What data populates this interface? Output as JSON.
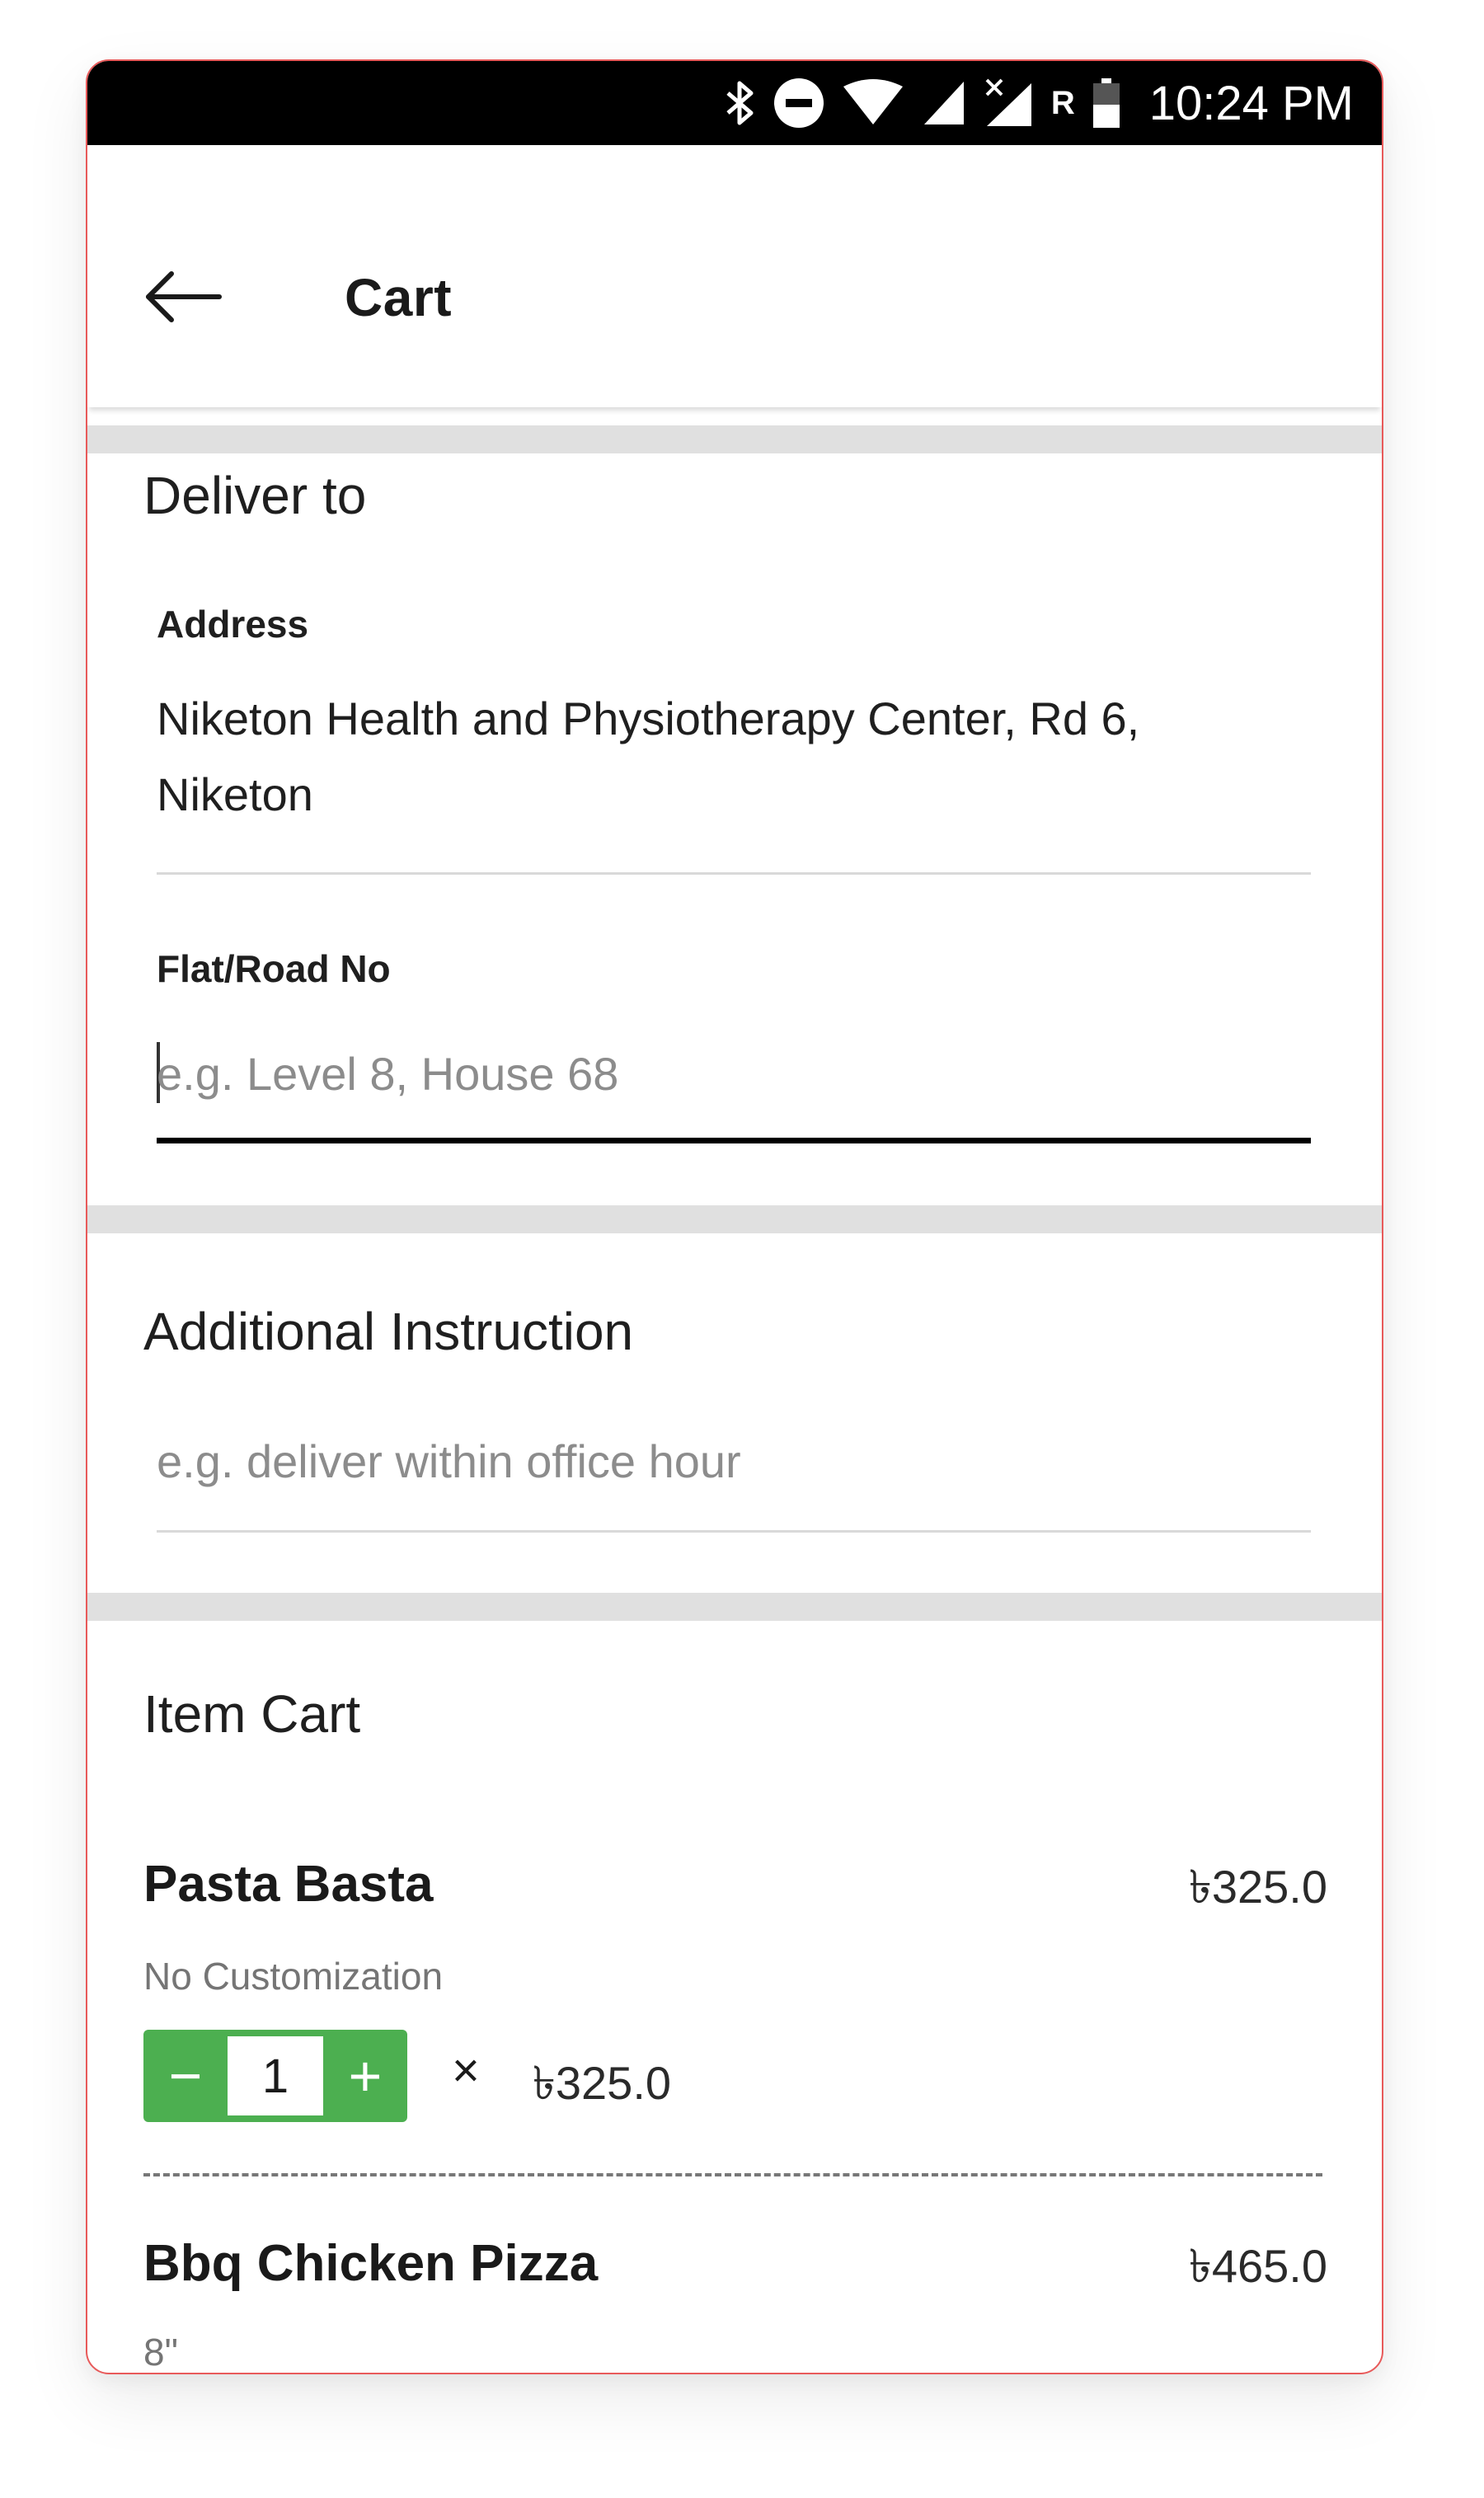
{
  "status_bar": {
    "carrier_letter": "R",
    "time": "10:24 PM",
    "icons": [
      "bluetooth-icon",
      "do-not-disturb-icon",
      "wifi-icon",
      "signal-icon",
      "signal-no-data-icon",
      "battery-icon"
    ]
  },
  "app_bar": {
    "title": "Cart",
    "back_icon": "arrow-left-icon"
  },
  "deliver": {
    "title": "Deliver to",
    "address_label": "Address",
    "address_line1": "Niketon Health and Physiotherapy Center, Rd 6,",
    "address_line2": "Niketon",
    "flat_label": "Flat/Road No",
    "flat_value": "",
    "flat_placeholder": "e.g. Level 8, House 68"
  },
  "instruction": {
    "title": "Additional Instruction",
    "value": "",
    "placeholder": "e.g. deliver within office hour"
  },
  "cart": {
    "title": "Item Cart",
    "items": [
      {
        "name": "Pasta Basta",
        "price": "৳325.0",
        "customization": "No Customization",
        "quantity": "1",
        "times": "×",
        "unit_price": "৳325.0",
        "minus": "−",
        "plus": "+"
      },
      {
        "name": "Bbq Chicken Pizza",
        "price": "৳465.0",
        "customization": "8\""
      }
    ]
  },
  "colors": {
    "accent_green": "#4caf50",
    "status_bar": "#000000",
    "section_gap": "#e0e0e0",
    "frame_border": "#e85a5a"
  }
}
